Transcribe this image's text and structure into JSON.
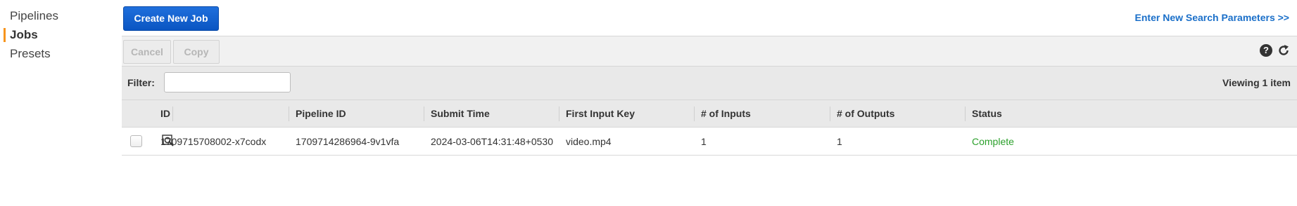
{
  "sidebar": {
    "items": [
      {
        "label": "Pipelines"
      },
      {
        "label": "Jobs",
        "active": true
      },
      {
        "label": "Presets"
      }
    ]
  },
  "header": {
    "create_button": "Create New Job",
    "search_link": "Enter New Search Parameters >>"
  },
  "toolbar": {
    "cancel_label": "Cancel",
    "copy_label": "Copy",
    "help_icon": "help-icon",
    "refresh_icon": "refresh-icon"
  },
  "filter": {
    "label": "Filter:",
    "value": "",
    "placeholder": "",
    "viewing_text": "Viewing 1 item"
  },
  "table": {
    "columns": [
      "ID",
      "Pipeline ID",
      "Submit Time",
      "First Input Key",
      "# of Inputs",
      "# of Outputs",
      "Status"
    ],
    "rows": [
      {
        "id": "1709715708002-x7codx",
        "pipeline_id": "1709714286964-9v1vfa",
        "submit_time": "2024-03-06T14:31:48+0530",
        "first_input_key": "video.mp4",
        "num_inputs": "1",
        "num_outputs": "1",
        "status": "Complete",
        "selected": false
      }
    ]
  },
  "colors": {
    "accent": "#f7941d",
    "primary_button": "#0a55c2",
    "link": "#1a6fc9",
    "status_complete": "#2ca02c"
  }
}
